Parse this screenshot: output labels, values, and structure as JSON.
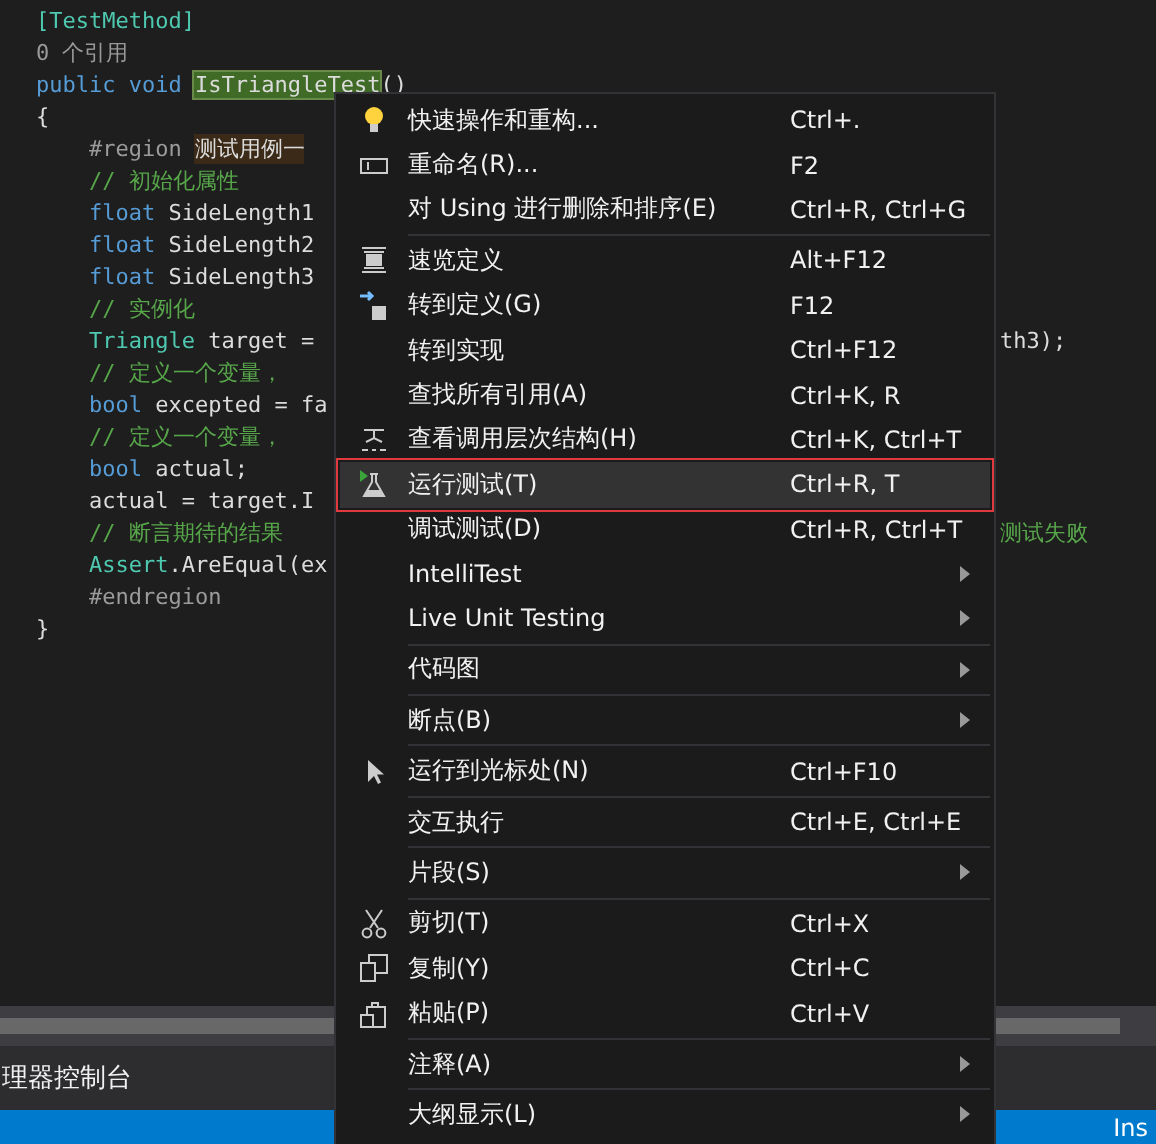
{
  "code_lines": [
    {
      "segments": [
        {
          "kind": "type",
          "text": "[TestMethod]"
        }
      ]
    },
    {
      "segments": [
        {
          "kind": "lens",
          "text": "0 个引用"
        }
      ]
    },
    {
      "segments": [
        {
          "kind": "keyword",
          "text": "public void "
        },
        {
          "kind": "match",
          "text": "IsTriangleTest"
        },
        {
          "kind": "plain",
          "text": "()"
        }
      ]
    },
    {
      "segments": [
        {
          "kind": "plain",
          "text": "{"
        }
      ]
    },
    {
      "segments": [
        {
          "kind": "region",
          "text": "    #region "
        },
        {
          "kind": "regionname",
          "text": "测试用例一"
        }
      ]
    },
    {
      "segments": [
        {
          "kind": "comment",
          "text": "    // 初始化属性"
        }
      ]
    },
    {
      "segments": [
        {
          "kind": "keyword",
          "text": "    float "
        },
        {
          "kind": "plain",
          "text": "SideLength1"
        }
      ]
    },
    {
      "segments": [
        {
          "kind": "keyword",
          "text": "    float "
        },
        {
          "kind": "plain",
          "text": "SideLength2"
        }
      ]
    },
    {
      "segments": [
        {
          "kind": "keyword",
          "text": "    float "
        },
        {
          "kind": "plain",
          "text": "SideLength3"
        }
      ]
    },
    {
      "segments": [
        {
          "kind": "comment",
          "text": "    // 实例化"
        }
      ]
    },
    {
      "segments": [
        {
          "kind": "type",
          "text": "    Triangle "
        },
        {
          "kind": "plain",
          "text": "target ="
        }
      ],
      "tail": {
        "kind": "plain",
        "text": "th3);"
      }
    },
    {
      "segments": [
        {
          "kind": "comment",
          "text": "    // 定义一个变量，"
        }
      ]
    },
    {
      "segments": [
        {
          "kind": "keyword",
          "text": "    bool "
        },
        {
          "kind": "plain",
          "text": "excepted = fa"
        }
      ]
    },
    {
      "segments": [
        {
          "kind": "comment",
          "text": "    // 定义一个变量，"
        }
      ]
    },
    {
      "segments": [
        {
          "kind": "keyword",
          "text": "    bool "
        },
        {
          "kind": "plain",
          "text": "actual;"
        }
      ]
    },
    {
      "segments": [
        {
          "kind": "plain",
          "text": "    actual = target.I"
        }
      ]
    },
    {
      "segments": [
        {
          "kind": "comment",
          "text": "    // 断言期待的结果"
        }
      ],
      "tail": {
        "kind": "comment",
        "text": "测试失败"
      }
    },
    {
      "segments": [
        {
          "kind": "type",
          "text": "    Assert"
        },
        {
          "kind": "plain",
          "text": ".AreEqual(ex"
        }
      ]
    },
    {
      "segments": [
        {
          "kind": "region",
          "text": "    #endregion"
        }
      ]
    },
    {
      "segments": [
        {
          "kind": "plain",
          "text": "}"
        }
      ]
    }
  ],
  "bottom_panel": {
    "tab": "理器控制台"
  },
  "status_bar": {
    "mode": "Ins"
  },
  "context_menu": [
    {
      "kind": "item",
      "label": "快速操作和重构...",
      "shortcut": "Ctrl+.",
      "selected": false
    },
    {
      "kind": "item",
      "label": "重命名(R)...",
      "shortcut": "F2",
      "selected": false
    },
    {
      "kind": "item",
      "label": "对 Using 进行删除和排序(E)",
      "shortcut": "Ctrl+R, Ctrl+G",
      "selected": false
    },
    {
      "kind": "separator"
    },
    {
      "kind": "item",
      "label": "速览定义",
      "shortcut": "Alt+F12",
      "selected": false
    },
    {
      "kind": "item",
      "label": "转到定义(G)",
      "shortcut": "F12",
      "selected": false
    },
    {
      "kind": "item",
      "label": "转到实现",
      "shortcut": "Ctrl+F12",
      "selected": false
    },
    {
      "kind": "item",
      "label": "查找所有引用(A)",
      "shortcut": "Ctrl+K, R",
      "selected": false
    },
    {
      "kind": "item",
      "label": "查看调用层次结构(H)",
      "shortcut": "Ctrl+K, Ctrl+T",
      "selected": false
    },
    {
      "kind": "item",
      "label": "运行测试(T)",
      "shortcut": "Ctrl+R, T",
      "selected": true
    },
    {
      "kind": "item",
      "label": "调试测试(D)",
      "shortcut": "Ctrl+R, Ctrl+T",
      "selected": false
    },
    {
      "kind": "item",
      "label": "IntelliTest",
      "submenu": true,
      "selected": false
    },
    {
      "kind": "item",
      "label": "Live Unit Testing",
      "submenu": true,
      "selected": false
    },
    {
      "kind": "separator"
    },
    {
      "kind": "item",
      "label": "代码图",
      "submenu": true,
      "selected": false
    },
    {
      "kind": "separator"
    },
    {
      "kind": "item",
      "label": "断点(B)",
      "submenu": true,
      "selected": false
    },
    {
      "kind": "separator"
    },
    {
      "kind": "item",
      "label": "运行到光标处(N)",
      "shortcut": "Ctrl+F10",
      "selected": false
    },
    {
      "kind": "separator"
    },
    {
      "kind": "item",
      "label": "交互执行",
      "shortcut": "Ctrl+E, Ctrl+E",
      "selected": false
    },
    {
      "kind": "separator"
    },
    {
      "kind": "item",
      "label": "片段(S)",
      "submenu": true,
      "selected": false
    },
    {
      "kind": "separator"
    },
    {
      "kind": "item",
      "label": "剪切(T)",
      "shortcut": "Ctrl+X",
      "selected": false
    },
    {
      "kind": "item",
      "label": "复制(Y)",
      "shortcut": "Ctrl+C",
      "selected": false
    },
    {
      "kind": "item",
      "label": "粘贴(P)",
      "shortcut": "Ctrl+V",
      "selected": false
    },
    {
      "kind": "separator"
    },
    {
      "kind": "item",
      "label": "注释(A)",
      "submenu": true,
      "selected": false
    },
    {
      "kind": "separator"
    },
    {
      "kind": "item",
      "label": "大纲显示(L)",
      "submenu": true,
      "selected": false
    }
  ]
}
